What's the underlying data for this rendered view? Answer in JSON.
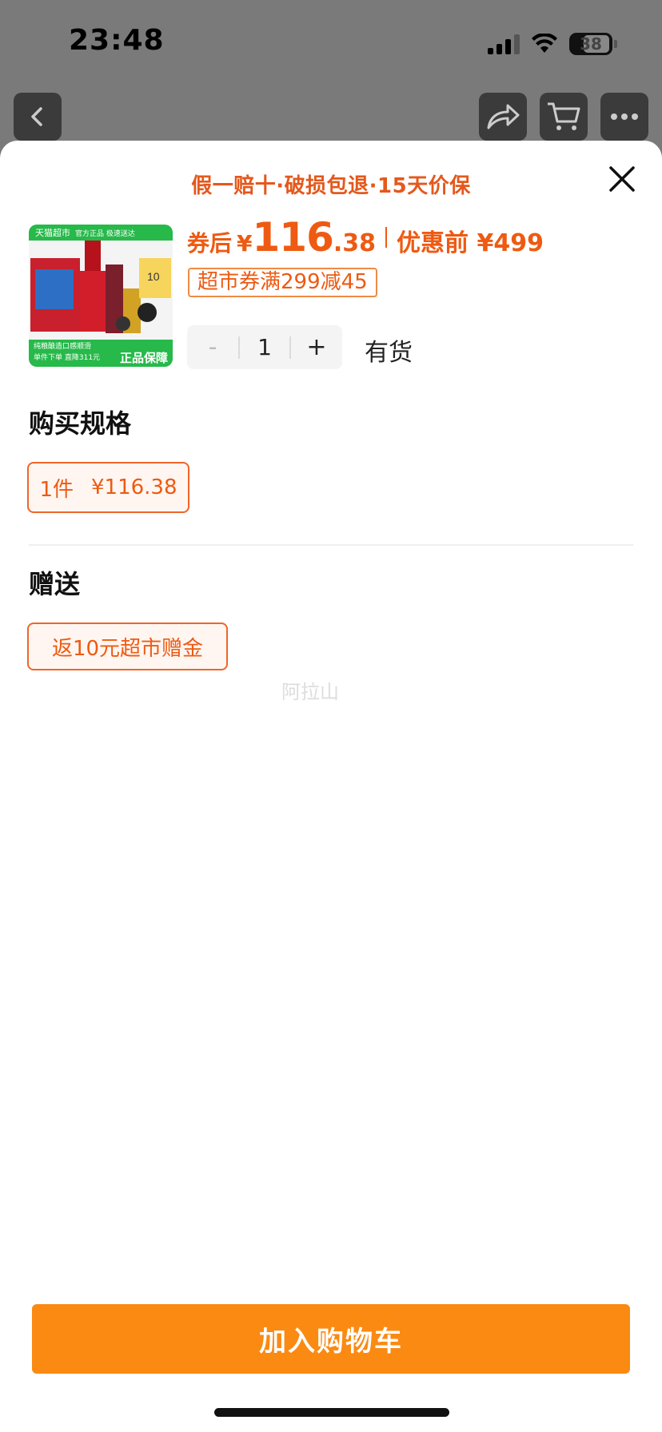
{
  "status_bar": {
    "time": "23:48",
    "battery": "38"
  },
  "nav": {
    "back_icon": "chevron-left-icon",
    "share_icon": "share-icon",
    "cart_icon": "cart-icon",
    "more_icon": "more-icon"
  },
  "sheet": {
    "guarantee": "假一赔十·破损包退·15天价保",
    "product": {
      "thumb_top": "天猫超市",
      "thumb_top_sub": "官方正品 极速送达",
      "thumb_badge": "10",
      "thumb_bottom_line1": "纯粮酿造口感顺滑",
      "thumb_bottom_line2": "单件下单 直降311元",
      "thumb_bottom_big": "正品保障"
    },
    "price": {
      "label": "券后",
      "currency": "¥",
      "integer": "116",
      "decimal": ".38",
      "original": "优惠前 ¥499"
    },
    "coupon": "超市券满299减45",
    "quantity": {
      "minus": "-",
      "value": "1",
      "plus": "+"
    },
    "stock": "有货",
    "spec_title": "购买规格",
    "spec_options": [
      {
        "name": "1件",
        "price": "¥116.38",
        "selected": true
      }
    ],
    "gift_title": "赠送",
    "gift_options": [
      {
        "label": "返10元超市赠金"
      }
    ],
    "watermark": "阿拉山",
    "add_to_cart": "加入购物车"
  },
  "colors": {
    "accent": "#ee5a12",
    "button": "#fb8a12"
  }
}
